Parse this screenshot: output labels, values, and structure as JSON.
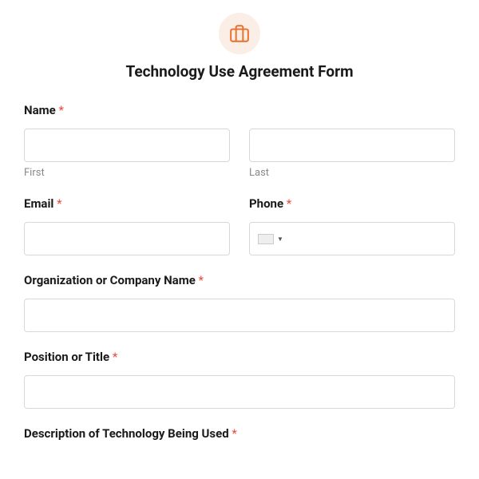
{
  "header": {
    "title": "Technology Use Agreement Form"
  },
  "fields": {
    "name": {
      "label": "Name",
      "required": "*",
      "first_sublabel": "First",
      "last_sublabel": "Last"
    },
    "email": {
      "label": "Email",
      "required": "*"
    },
    "phone": {
      "label": "Phone",
      "required": "*"
    },
    "organization": {
      "label": "Organization or Company Name",
      "required": "*"
    },
    "position": {
      "label": "Position or Title",
      "required": "*"
    },
    "description": {
      "label": "Description of Technology Being Used",
      "required": "*"
    }
  }
}
